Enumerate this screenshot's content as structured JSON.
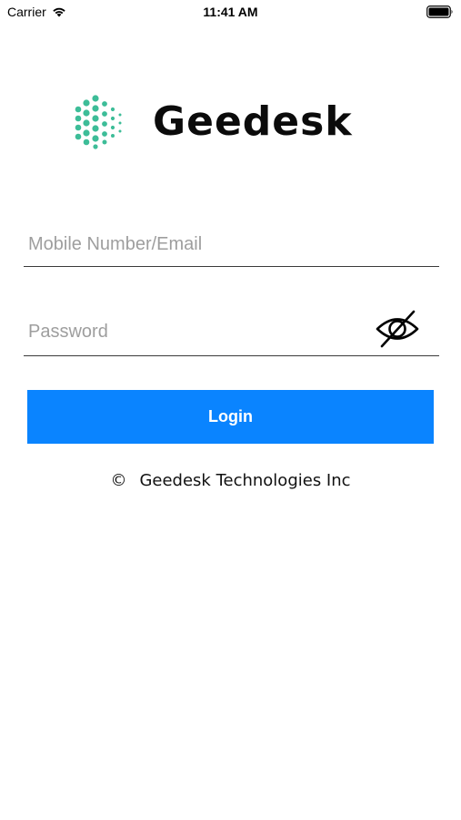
{
  "status_bar": {
    "carrier": "Carrier",
    "time": "11:41 AM"
  },
  "brand": {
    "name": "Geedesk",
    "mark_color": "#3dbd98"
  },
  "form": {
    "email_placeholder": "Mobile Number/Email",
    "email_value": "",
    "password_placeholder": "Password",
    "password_value": "",
    "password_toggle_icon": "eye-slash-icon"
  },
  "login_button": {
    "label": "Login",
    "color": "#0a84ff"
  },
  "footer": {
    "symbol": "©",
    "text": "Geedesk Technologies Inc"
  }
}
